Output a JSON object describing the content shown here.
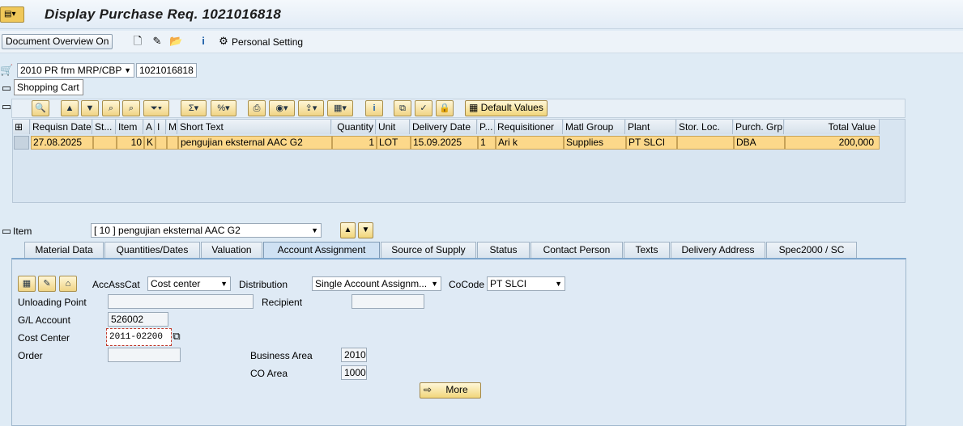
{
  "window": {
    "title": "Display Purchase Req. 1021016818"
  },
  "toolbar": {
    "document_overview": "Document Overview On",
    "personal_setting": "Personal Setting"
  },
  "header": {
    "doc_type": "2010 PR frm MRP/CBP",
    "doc_number": "1021016818",
    "tooltip": "Shopping Cart"
  },
  "grid_toolbar": {
    "default_values": "Default Values"
  },
  "table": {
    "columns": [
      "Requisn Date",
      "St...",
      "Item",
      "A",
      "I",
      "M:",
      "Short Text",
      "Quantity",
      "Unit",
      "Delivery Date",
      "P...",
      "Requisitioner",
      "Matl Group",
      "Plant",
      "Stor. Loc.",
      "Purch. Grp",
      "Total Value"
    ],
    "rows": [
      [
        "27.08.2025",
        "",
        "10",
        "K",
        "",
        "",
        "pengujian eksternal AAC G2",
        "1",
        "LOT",
        "15.09.2025",
        "1",
        "Ari k",
        "Supplies",
        "PT SLCI",
        "",
        "DBA",
        "200,000"
      ]
    ]
  },
  "item_selector": {
    "label": "Item",
    "value": "[ 10 ] pengujian eksternal AAC G2"
  },
  "tabs": [
    "Material Data",
    "Quantities/Dates",
    "Valuation",
    "Account Assignment",
    "Source of Supply",
    "Status",
    "Contact Person",
    "Texts",
    "Delivery Address",
    "Spec2000 / SC"
  ],
  "account": {
    "acc_ass_cat_label": "AccAssCat",
    "acc_ass_cat": "Cost center",
    "distribution_label": "Distribution",
    "distribution": "Single Account Assignm...",
    "cocode_label": "CoCode",
    "cocode": "PT SLCI",
    "unloading_label": "Unloading Point",
    "unloading": "",
    "recipient_label": "Recipient",
    "recipient": "",
    "gl_label": "G/L Account",
    "gl": "526002",
    "cost_center_label": "Cost Center",
    "cost_center": "2011-02200",
    "order_label": "Order",
    "order": "",
    "business_area_label": "Business Area",
    "business_area": "2010",
    "co_area_label": "CO Area",
    "co_area": "1000",
    "more": "More"
  }
}
